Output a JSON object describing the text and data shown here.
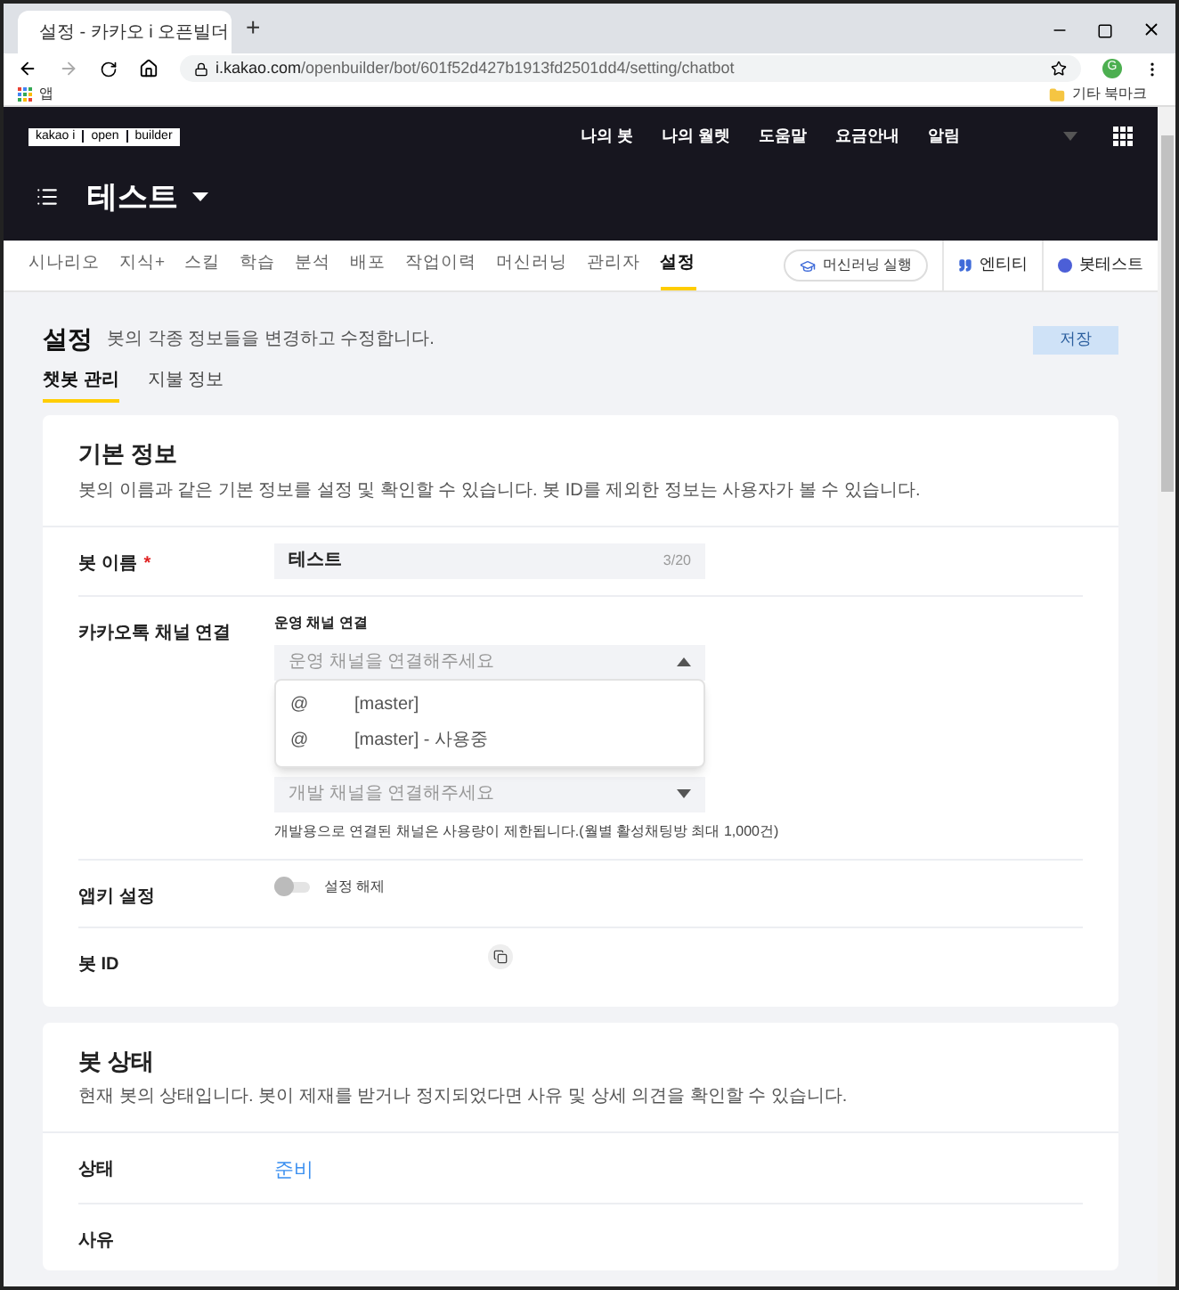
{
  "browser": {
    "tab_title": "설정 - 카카오 i 오픈빌더",
    "new_tab": "+",
    "url_host": "i.kakao.com",
    "url_path": "/openbuilder/bot/601f52d427b1913fd2501dd4/setting/chatbot",
    "profile_initial": "G",
    "bookmarks": [
      {
        "label": "앱"
      }
    ],
    "other_bookmarks": "기타 북마크"
  },
  "header": {
    "logo": [
      "kakao i",
      "open",
      "builder"
    ],
    "nav": [
      "나의 봇",
      "나의 월렛",
      "도움말",
      "요금안내",
      "알림"
    ],
    "bot_name": "테스트"
  },
  "tabs": [
    {
      "label": "시나리오",
      "selected": false
    },
    {
      "label": "지식+",
      "selected": false
    },
    {
      "label": "스킬",
      "selected": false
    },
    {
      "label": "학습",
      "selected": false
    },
    {
      "label": "분석",
      "selected": false
    },
    {
      "label": "배포",
      "selected": false
    },
    {
      "label": "작업이력",
      "selected": false
    },
    {
      "label": "머신러닝",
      "selected": false
    },
    {
      "label": "관리자",
      "selected": false
    },
    {
      "label": "설정",
      "selected": true
    }
  ],
  "toolbar": {
    "ml_button": "머신러닝 실행",
    "entity": "엔티티",
    "bot_test": "봇테스트"
  },
  "page": {
    "title": "설정",
    "subtitle": "봇의 각종 정보들을 변경하고 수정합니다.",
    "save": "저장",
    "save_disabled": true
  },
  "subtabs": [
    {
      "label": "챗봇 관리",
      "selected": true
    },
    {
      "label": "지불 정보",
      "selected": false
    }
  ],
  "basic_info": {
    "title": "기본 정보",
    "description": "봇의 이름과 같은 기본 정보를 설정 및 확인할 수 있습니다. 봇 ID를 제외한 정보는 사용자가 볼 수 있습니다.",
    "bot_name": {
      "label": "봇 이름",
      "required": true,
      "required_mark": "*",
      "value": "테스트",
      "counter": "3/20"
    },
    "channel": {
      "label": "카카오톡 채널 연결",
      "live_label": "운영 채널 연결",
      "live_placeholder": "운영 채널을 연결해주세요",
      "expanded": true,
      "options": [
        {
          "at": "@",
          "name": "[master]"
        },
        {
          "at": "@",
          "name": "[master] - 사용중"
        }
      ],
      "dev_placeholder": "개발 채널을 연결해주세요",
      "dev_note": "개발용으로 연결된 채널은 사용량이 제한됩니다.(월별 활성채팅방 최대 1,000건)"
    },
    "appkey": {
      "label": "앱키 설정",
      "on": false,
      "state_text": "설정 해제"
    },
    "bot_id": {
      "label": "봇 ID"
    }
  },
  "bot_status": {
    "title": "봇 상태",
    "description": "현재 봇의 상태입니다. 봇이 제재를 받거나 정지되었다면 사유 및 상세 의견을 확인할 수 있습니다.",
    "status_label": "상태",
    "status_value": "준비",
    "reason_label": "사유"
  }
}
